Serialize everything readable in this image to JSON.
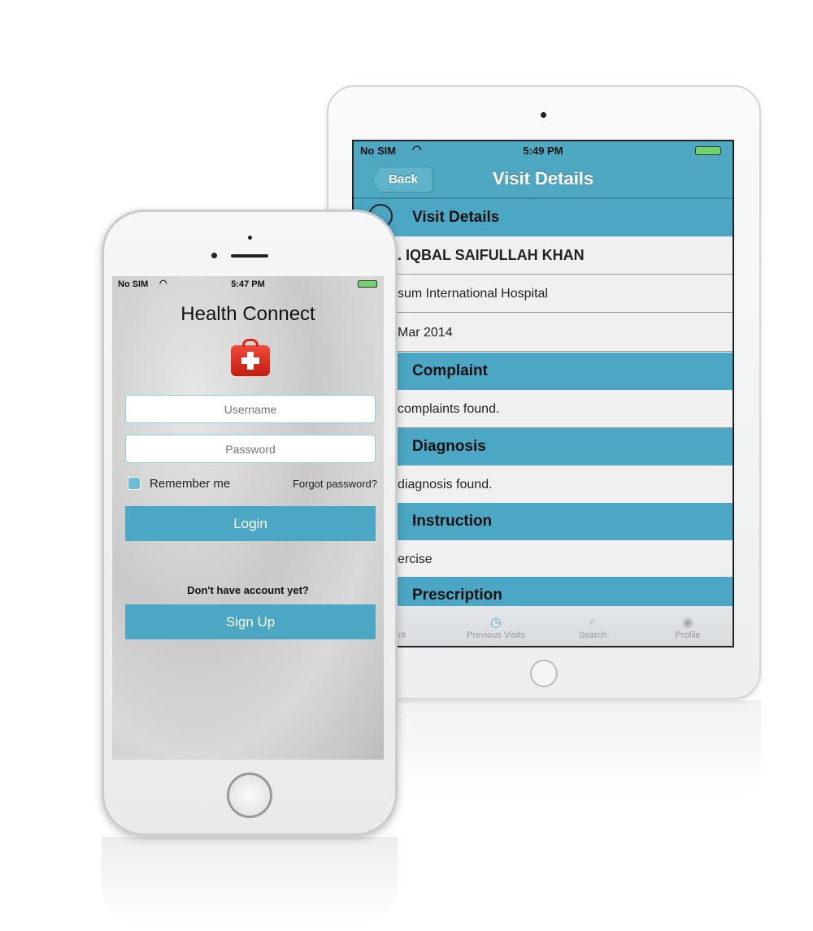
{
  "tablet": {
    "status": {
      "carrier": "No SIM",
      "time": "5:49 PM"
    },
    "nav": {
      "back_label": "Back",
      "title": "Visit Details"
    },
    "sections": [
      {
        "header": "Visit Details",
        "rows": [
          ". IQBAL SAIFULLAH KHAN",
          "sum International Hospital",
          "Mar 2014"
        ]
      },
      {
        "header": "Complaint",
        "rows": [
          "complaints found."
        ]
      },
      {
        "header": "Diagnosis",
        "rows": [
          "diagnosis found."
        ]
      },
      {
        "header": "Instruction",
        "rows": [
          "ercise"
        ]
      },
      {
        "header": "Prescription",
        "rows": []
      }
    ],
    "tabs": [
      {
        "label": "ntment",
        "icon": "calendar-icon"
      },
      {
        "label": "Previous Visits",
        "icon": "history-icon"
      },
      {
        "label": "Search",
        "icon": "search-icon"
      },
      {
        "label": "Profile",
        "icon": "profile-icon"
      }
    ]
  },
  "phone": {
    "status": {
      "carrier": "No SIM",
      "time": "5:47 PM"
    },
    "app_title": "Health Connect",
    "username_placeholder": "Username",
    "password_placeholder": "Password",
    "remember_label": "Remember me",
    "forgot_label": "Forgot password?",
    "login_label": "Login",
    "no_account_text": "Don't have account yet?",
    "signup_label": "Sign Up"
  },
  "colors": {
    "accent": "#4ba7c3",
    "battery": "#6fd46a",
    "logo_red": "#d9261c"
  }
}
